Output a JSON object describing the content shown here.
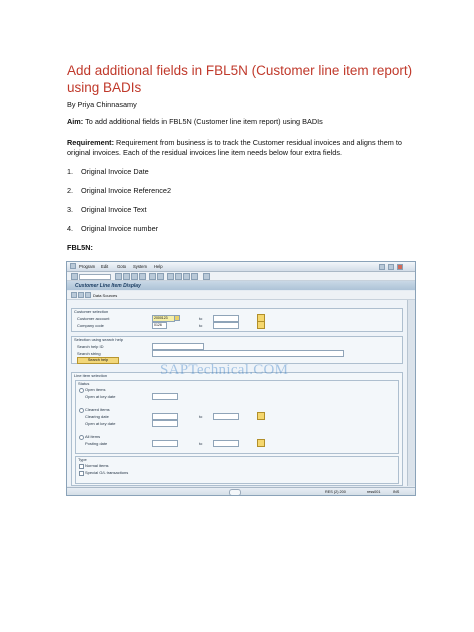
{
  "doc": {
    "title": "Add additional fields in FBL5N (Customer line item report) using BADIs",
    "author": "By Priya Chinnasamy",
    "aim_label": "Aim:",
    "aim_text": " To add additional fields in FBL5N (Customer line item report) using BADIs",
    "req_label": "Requirement:",
    "req_text": " Requirement from business is to track the Customer residual invoices and aligns them to original invoices. Each of the residual invoices line item needs below four extra fields.",
    "list": [
      {
        "num": "1.",
        "text": "Original Invoice Date"
      },
      {
        "num": "2.",
        "text": "Original Invoice Reference2"
      },
      {
        "num": "3.",
        "text": "Original Invoice Text"
      },
      {
        "num": "4.",
        "text": "Original Invoice number"
      }
    ],
    "section_label": "FBL5N:"
  },
  "sap": {
    "menu": [
      "Program",
      "Edit",
      "Goto",
      "System",
      "Help"
    ],
    "screen_title": "Customer Line Item Display",
    "app_button": "Data Sources",
    "customer_selection": "Customer selection",
    "customer_account_label": "Customer account",
    "customer_account_value": "2000123",
    "company_code_label": "Company code",
    "company_code_value": "0126",
    "to_label": "to",
    "search_help_section": "Selection using search help",
    "search_help_id_label": "Search help ID",
    "search_string_label": "Search string",
    "search_help_button": "Search help",
    "line_item_section": "Line item selection",
    "status_label": "Status",
    "open_items_label": "Open items",
    "open_key_date_label": "Open at key date",
    "cleared_items_label": "Cleared items",
    "clearing_date_label": "Clearing date",
    "open_key_date2_label": "Open at key date",
    "all_items_label": "All items",
    "posting_date_label": "Posting date",
    "type_label": "Type",
    "normal_items_label": "Normal items",
    "special_gl_label": "Special G/L transactions",
    "watermark": "SAPTechnical.COM",
    "status_bar_text": "RES (2) 200",
    "status_bar_server": "ress001",
    "status_bar_mode": "INS"
  }
}
